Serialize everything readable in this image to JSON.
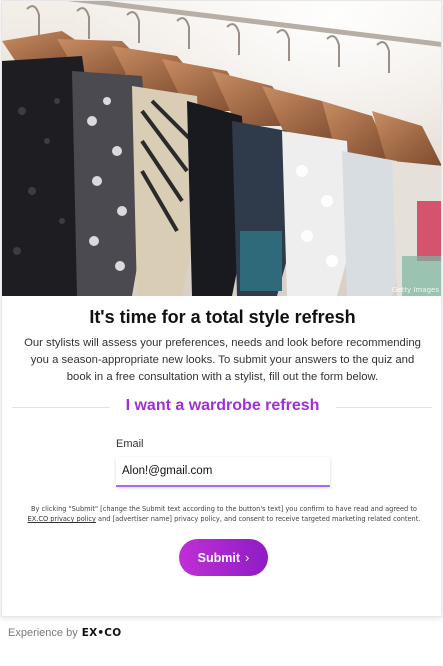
{
  "hero": {
    "image_description": "rack of sequined and embellished dresses on wooden hangers",
    "credit": "Getty Images"
  },
  "heading": {
    "title": "It's time for a total style refresh",
    "description": "Our stylists will assess your preferences, needs and look before recommending you a season-appropriate new looks. To submit your answers to the quiz and book in a free consultation with a stylist, fill out the form below."
  },
  "section": {
    "title": "I want a wardrobe refresh"
  },
  "form": {
    "email_label": "Email",
    "email_value": "Alon!@gmail.com",
    "consent_before": "By clicking \"Submit\" [change the Submit text according to the button's text] you confirm to have read and agreed to ",
    "consent_link": "EX.CO privacy policy",
    "consent_after": " and [advertiser name] privacy policy, and consent to receive targeted marketing related content.",
    "submit_label": "Submit",
    "submit_icon": "chevron-right-icon"
  },
  "footer": {
    "prefix": "Experience by",
    "brand": "EX•CO"
  },
  "colors": {
    "accent": "#a22fd4",
    "button_start": "#c02fd6",
    "button_end": "#8e1cc6",
    "input_underline": "#a66bf0"
  }
}
